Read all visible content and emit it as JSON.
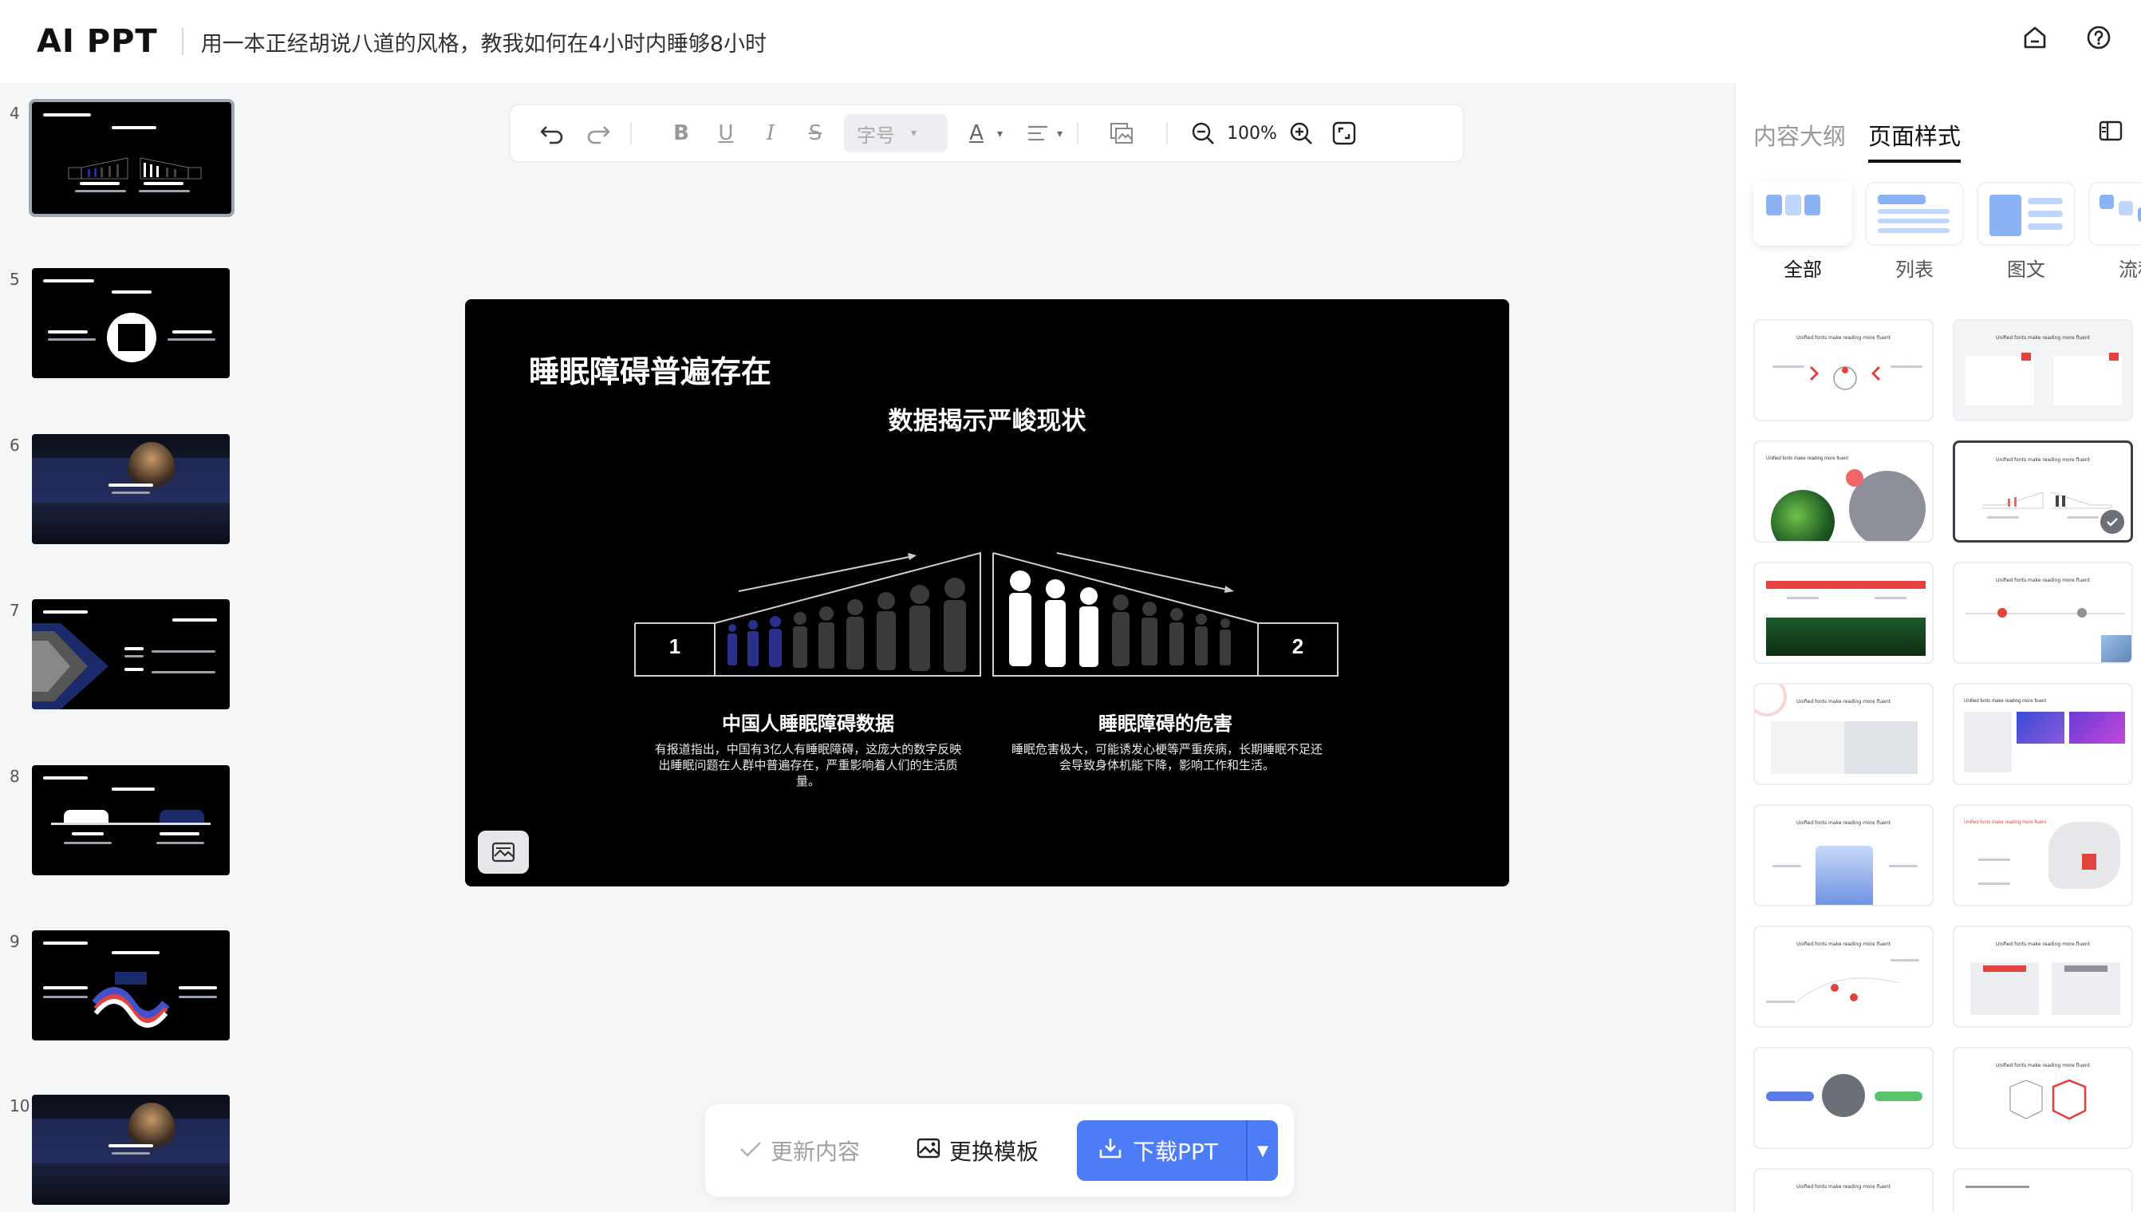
{
  "header": {
    "logo": "AI PPT",
    "title": "用一本正经胡说八道的风格，教我如何在4小时内睡够8小时",
    "home_icon": "home-icon",
    "help_icon": "help-icon"
  },
  "thumbnails": [
    {
      "number": "4"
    },
    {
      "number": "5"
    },
    {
      "number": "6"
    },
    {
      "number": "7"
    },
    {
      "number": "8"
    },
    {
      "number": "9"
    },
    {
      "number": "10"
    }
  ],
  "toolbar": {
    "font_size_placeholder": "字号",
    "zoom": "100%",
    "bold": "B",
    "underline": "U",
    "italic": "I",
    "strike": "S",
    "font_color": "A"
  },
  "slide": {
    "title": "睡眠障碍普遍存在",
    "subtitle": "数据揭示严峻现状",
    "left_number": "1",
    "right_number": "2",
    "left_heading": "中国人睡眠障碍数据",
    "left_body": "有报道指出，中国有3亿人有睡眠障碍，这庞大的数字反映出睡眠问题在人群中普遍存在，严重影响着人们的生活质量。",
    "right_heading": "睡眠障碍的危害",
    "right_body": "睡眠危害极大，可能诱发心梗等严重疾病，长期睡眠不足还会导致身体机能下降，影响工作和生活。"
  },
  "actions": {
    "update": "更新内容",
    "change_template": "更换模板",
    "download": "下载PPT"
  },
  "right_panel": {
    "tabs": [
      "内容大纲",
      "页面样式"
    ],
    "categories": [
      "全部",
      "列表",
      "图文",
      "流程"
    ],
    "layout_card_title": "Unified fonts make reading more fluent"
  },
  "colors": {
    "accent": "#4d7cf7",
    "slide_bg": "#000000",
    "figure_blue": "#2a2f8a",
    "figure_gray": "#3a3a3a"
  }
}
